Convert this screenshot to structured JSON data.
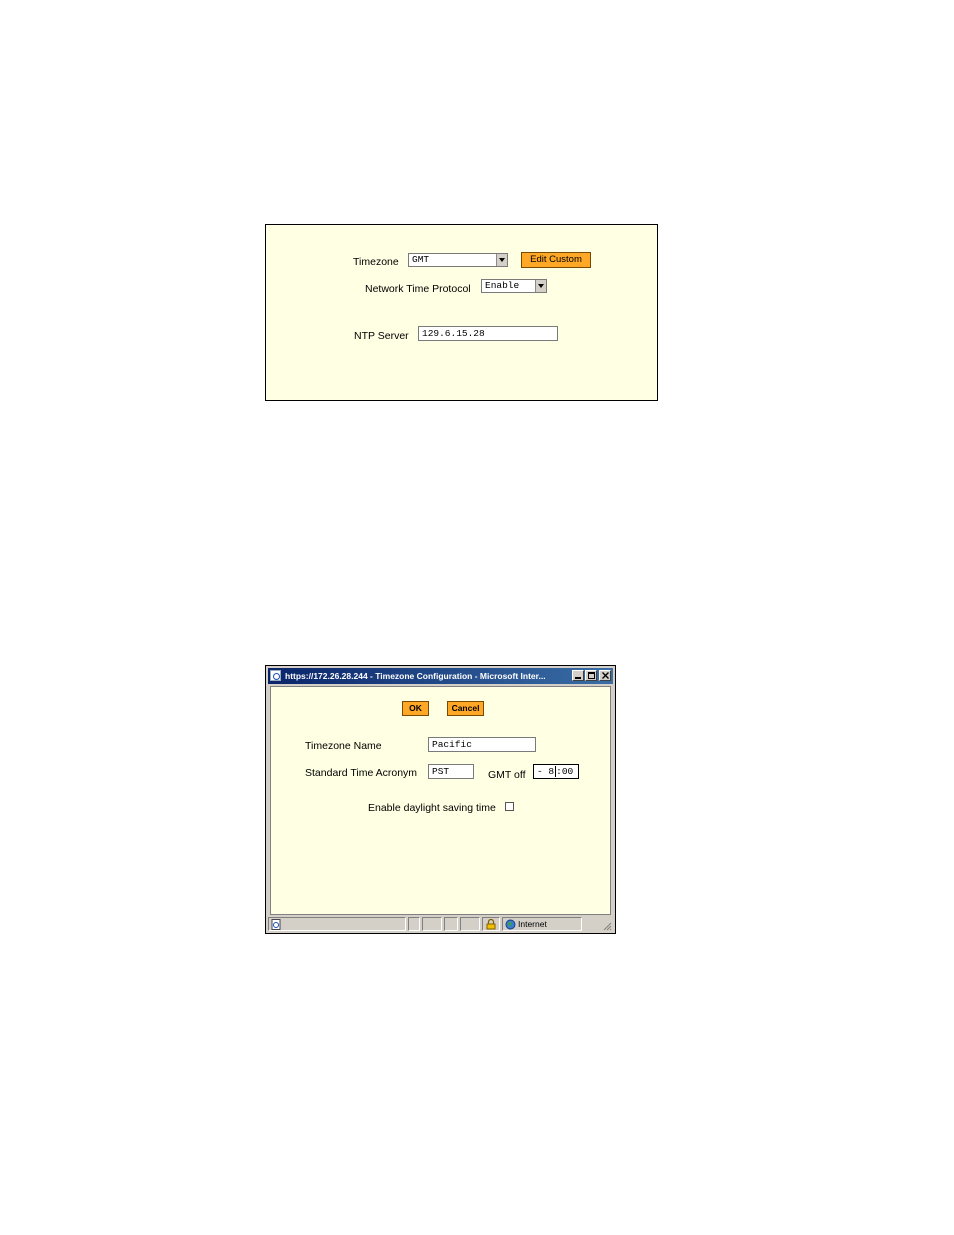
{
  "settings_panel": {
    "timezone_label": "Timezone",
    "timezone_value": "GMT",
    "edit_custom_label": "Edit Custom",
    "ntp_label": "Network Time Protocol",
    "ntp_value": "Enable",
    "ntp_server_label": "NTP Server",
    "ntp_server_value": "129.6.15.28"
  },
  "popup": {
    "title": "https://172.26.28.244 - Timezone Configuration - Microsoft Inter...",
    "ok_label": "OK",
    "cancel_label": "Cancel",
    "timezone_name_label": "Timezone Name",
    "timezone_name_value": "Pacific",
    "acronym_label": "Standard Time Acronym",
    "acronym_value": "PST",
    "gmt_offset_label": "GMT off",
    "gmt_offset_hours": "- 8",
    "gmt_offset_minutes": "00",
    "dst_label": "Enable daylight saving time",
    "status_zone": "Internet"
  },
  "colors": {
    "panel_background": "#ffffe4",
    "button_orange": "#ffa726",
    "titlebar_start": "#0a246a"
  }
}
